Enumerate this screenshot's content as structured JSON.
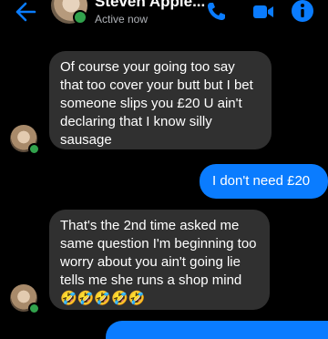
{
  "header": {
    "contact_name": "Steven Apple...",
    "status": "Active now",
    "icons": [
      "back-arrow-icon",
      "phone-icon",
      "video-camera-icon",
      "info-icon"
    ],
    "accent_color": "#0a7cff"
  },
  "messages": [
    {
      "direction": "incoming",
      "text": "Of course your going too say that too cover your butt but I bet someone slips you £20 U ain't declaring that I know silly sausage"
    },
    {
      "direction": "outgoing",
      "text": "I don't need £20"
    },
    {
      "direction": "incoming",
      "text": "That's the 2nd time asked me same question I'm beginning too worry about you ain't going lie tells me she runs a shop mind 🤣🤣🤣🤣🤣"
    },
    {
      "direction": "outgoing",
      "text": ""
    }
  ]
}
